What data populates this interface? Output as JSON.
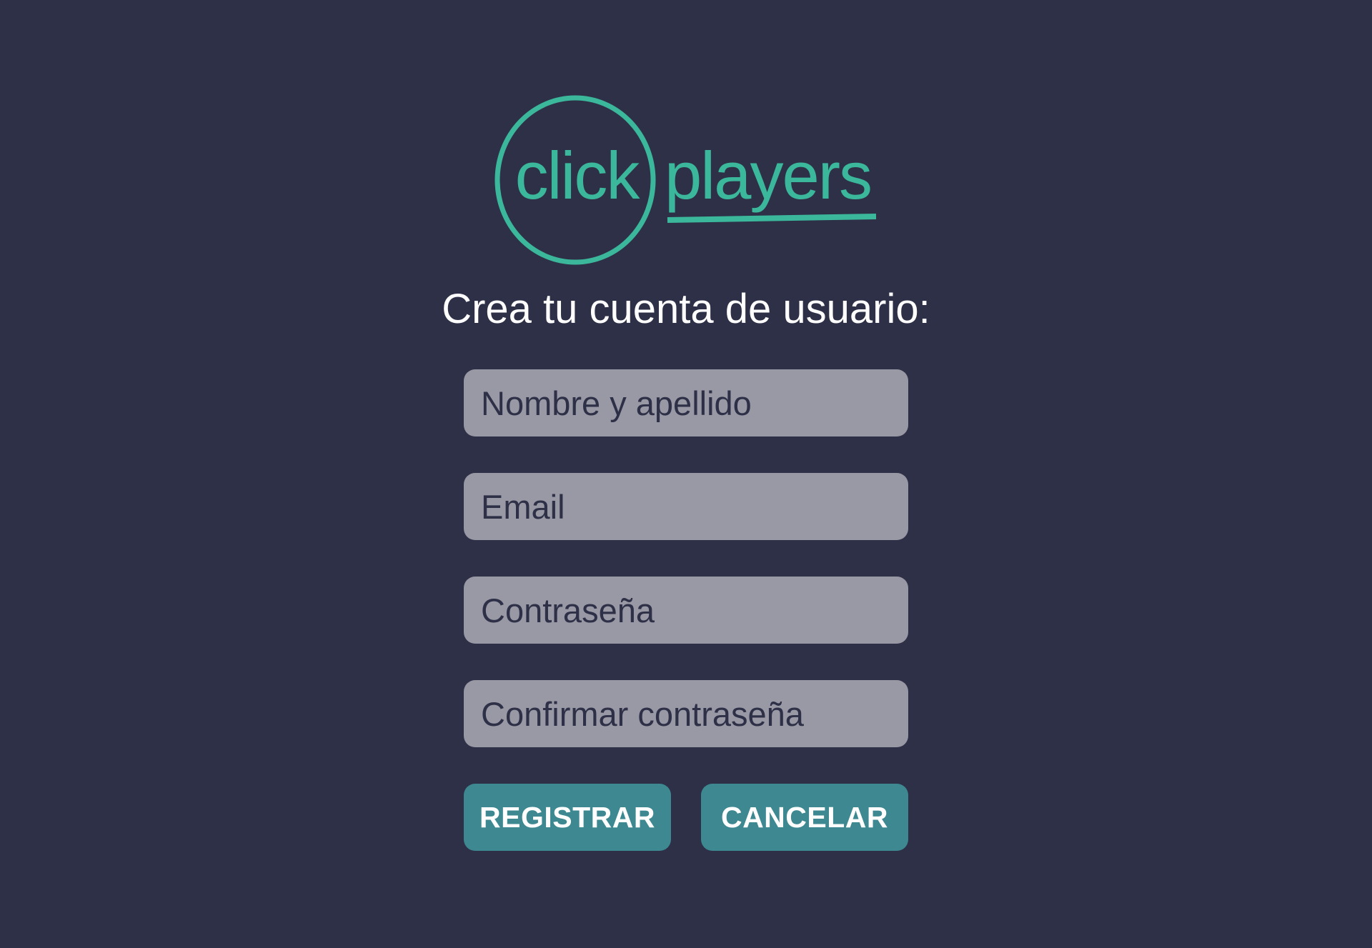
{
  "brand": {
    "logo_part1": "click",
    "logo_part2": "players",
    "accent_color": "#3bb89b"
  },
  "colors": {
    "background": "#2e3047",
    "field_background": "#9998a5",
    "button_background": "#3d8891",
    "text_light": "#ffffff"
  },
  "form": {
    "title": "Crea tu cuenta de usuario:",
    "fields": {
      "name_placeholder": "Nombre y apellido",
      "email_placeholder": "Email",
      "password_placeholder": "Contraseña",
      "confirm_password_placeholder": "Confirmar contraseña"
    },
    "buttons": {
      "register_label": "REGISTRAR",
      "cancel_label": "CANCELAR"
    }
  }
}
